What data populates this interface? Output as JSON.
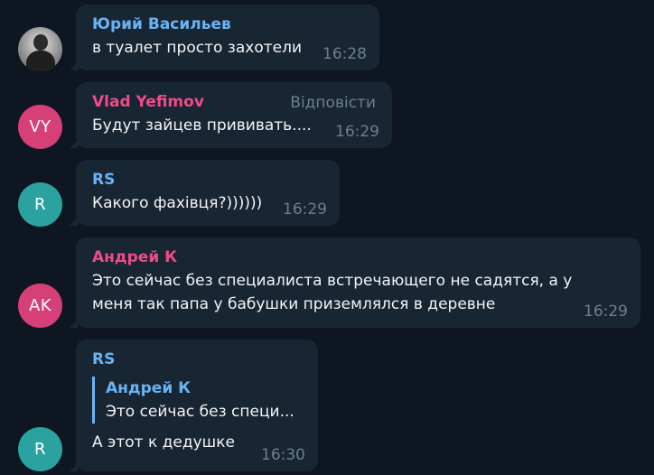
{
  "messages": [
    {
      "sender": "Юрий Васильев",
      "text": "в туалет просто захотели",
      "time": "16:28",
      "avatar_initials": "",
      "name_color": "#6ab3f3"
    },
    {
      "sender": "Vlad Yefimov",
      "text": "Будут зайцев прививать....",
      "time": "16:29",
      "avatar_initials": "VY",
      "name_color": "#ee4c87",
      "avatar_color": "#d63f78",
      "reply_label": "Відповісти"
    },
    {
      "sender": "RS",
      "text": "Какого  фахівця?))))))",
      "time": "16:29",
      "avatar_initials": "R",
      "name_color": "#6ab3f3",
      "avatar_color": "#2aa3a0"
    },
    {
      "sender": "Андрей К",
      "text_lines": [
        "Это сейчас без специалиста встречающего не садятся, а у",
        "меня так папа у бабушки приземлялся в деревне"
      ],
      "time": "16:29",
      "avatar_initials": "AK",
      "name_color": "#ee4c87",
      "avatar_color": "#d63f78"
    },
    {
      "sender": "RS",
      "quote": {
        "name": "Андрей К",
        "text": "Это сейчас без специ..."
      },
      "text": "А этот к дедушке",
      "time": "16:30",
      "avatar_initials": "R",
      "name_color": "#6ab3f3",
      "avatar_color": "#2aa3a0"
    }
  ]
}
